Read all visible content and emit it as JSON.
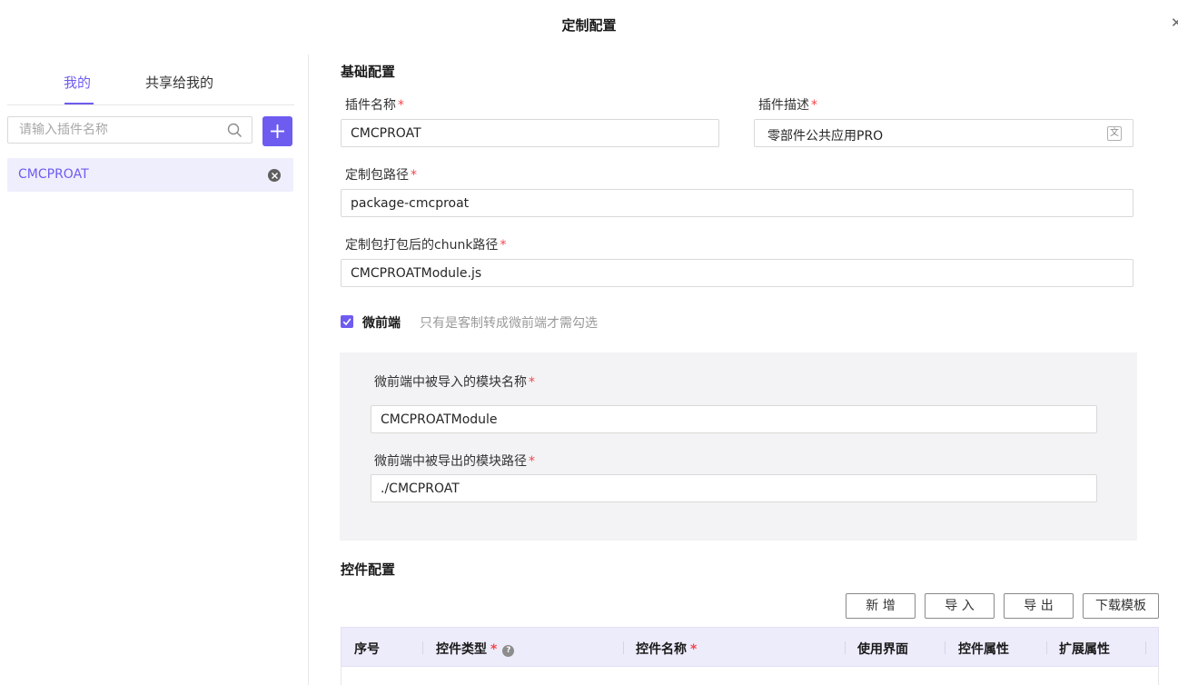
{
  "dialog": {
    "title": "定制配置",
    "close_icon": "close-icon"
  },
  "left": {
    "tabs": [
      {
        "label": "我的",
        "active": true
      },
      {
        "label": "共享给我的",
        "active": false
      }
    ],
    "search": {
      "placeholder": "请输入插件名称",
      "value": ""
    },
    "add_icon": "plus-icon",
    "plugins": [
      {
        "name": "CMCPROAT",
        "selected": true
      }
    ]
  },
  "basic": {
    "section_title": "基础配置",
    "plugin_name": {
      "label": "插件名称",
      "value": "CMCPROAT"
    },
    "plugin_desc": {
      "label": "插件描述",
      "value": "零部件公共应用PRO"
    },
    "package_path": {
      "label": "定制包路径",
      "value": "package-cmcproat"
    },
    "chunk_path": {
      "label": "定制包打包后的chunk路径",
      "value": "CMCPROATModule.js"
    },
    "micro_frontend": {
      "label": "微前端",
      "hint": "只有是客制转成微前端才需勾选",
      "checked": true
    },
    "import_module": {
      "label": "微前端中被导入的模块名称",
      "value": "CMCPROATModule"
    },
    "export_path": {
      "label": "微前端中被导出的模块路径",
      "value": "./CMCPROAT"
    },
    "required_mark": "*"
  },
  "controls": {
    "section_title": "控件配置",
    "buttons": {
      "add": "新 增",
      "import": "导 入",
      "export": "导 出",
      "download": "下载模板"
    },
    "columns": {
      "seq": "序号",
      "type": "控件类型",
      "name": "控件名称",
      "ui": "使用界面",
      "attr": "控件属性",
      "ext": "扩展属性"
    },
    "help_mark": "?"
  },
  "colors": {
    "accent": "#6e5cf0",
    "required": "#f5454b",
    "table_header": "#edecfb"
  }
}
